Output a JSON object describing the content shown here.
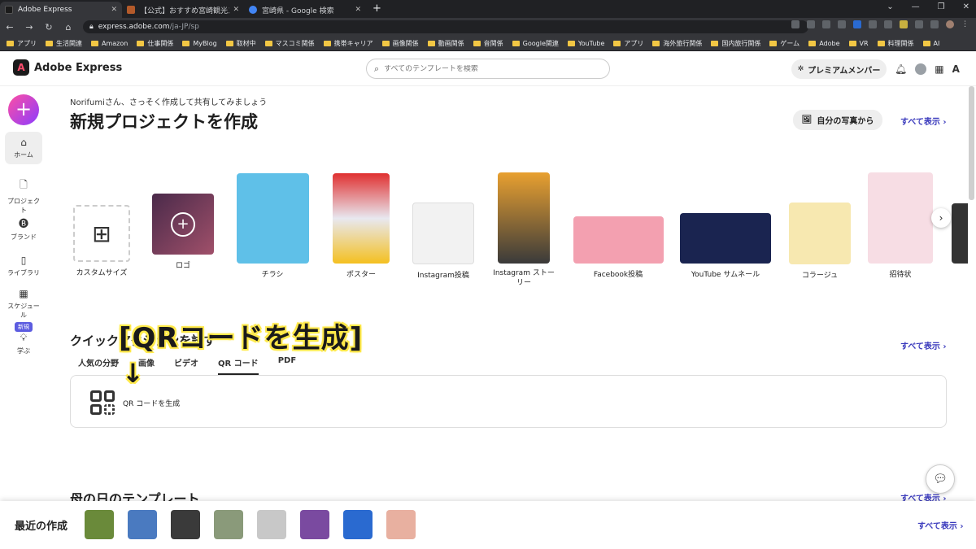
{
  "browser": {
    "tabs": [
      {
        "title": "Adobe Express",
        "color": "#1b1b1b",
        "active": true
      },
      {
        "title": "【公式】おすすめ宮崎観光スポット／",
        "color": "#b35a2a",
        "active": false
      },
      {
        "title": "宮崎県 - Google 検索",
        "color": "#4285f4",
        "active": false
      }
    ],
    "url_host": "express.adobe.com",
    "url_path": "/ja-JP/sp",
    "bookmarks": [
      "アプリ",
      "生活関連",
      "Amazon",
      "仕事関係",
      "MyBlog",
      "取材中",
      "マスコミ関係",
      "携帯キャリア",
      "画像関係",
      "動画関係",
      "音関係",
      "Google関連",
      "YouTube",
      "アプリ",
      "海外旅行関係",
      "国内旅行関係",
      "ゲーム",
      "Adobe",
      "VR",
      "料理関係",
      "AI"
    ]
  },
  "header": {
    "app_name": "Adobe Express",
    "search_placeholder": "すべてのテンプレートを検索",
    "premium_label": "プレミアムメンバー"
  },
  "sidebar": {
    "items": [
      {
        "label": "ホーム",
        "icon": "home-icon"
      },
      {
        "label": "プロジェクト",
        "icon": "file-icon"
      },
      {
        "label": "ブランド",
        "icon": "brand-icon"
      },
      {
        "label": "ライブラリ",
        "icon": "library-icon"
      },
      {
        "label": "スケジュール",
        "icon": "calendar-icon"
      },
      {
        "label": "学ぶ",
        "icon": "lightbulb-icon"
      }
    ],
    "new_badge": "新規"
  },
  "main": {
    "greeting": "Norifumiさん、さっそく作成して共有してみましょう",
    "title": "新規プロジェクトを作成",
    "photo_button": "自分の写真から",
    "see_all": "すべて表示",
    "templates": [
      {
        "label": "カスタムサイズ"
      },
      {
        "label": "ロゴ",
        "color": "#6b3a5a"
      },
      {
        "label": "チラシ",
        "color": "#5fc0e8"
      },
      {
        "label": "ポスター",
        "color": "#e8e8f0"
      },
      {
        "label": "Instagram投稿",
        "color": "#f2f2f2"
      },
      {
        "label": "Instagram ストーリー",
        "color": "#e8a030"
      },
      {
        "label": "Facebook投稿",
        "color": "#f3a0b0"
      },
      {
        "label": "YouTube サムネール",
        "color": "#1a2450"
      },
      {
        "label": "コラージュ",
        "color": "#f7e8b0"
      },
      {
        "label": "招待状",
        "color": "#f7dde4"
      }
    ],
    "quick_actions_title": "クイックアクションを試す",
    "quick_tabs": [
      "人気の分野",
      "画像",
      "ビデオ",
      "QR コード",
      "PDF"
    ],
    "quick_tab_selected": "QR コード",
    "qr_action_label": "QR コードを生成",
    "overlay_text": "[QRコードを生成]",
    "overlay_arrow": "↓",
    "mothers_day_title": "母の日のテンプレート"
  },
  "recent": {
    "label": "最近の作成",
    "see_all": "すべて表示",
    "thumbs": [
      "#6a8a3a",
      "#4a7ac0",
      "#3a3a3a",
      "#8a9a7a",
      "#c8c8c8",
      "#7a4aa0",
      "#2a6ad0",
      "#e8b0a0"
    ]
  }
}
